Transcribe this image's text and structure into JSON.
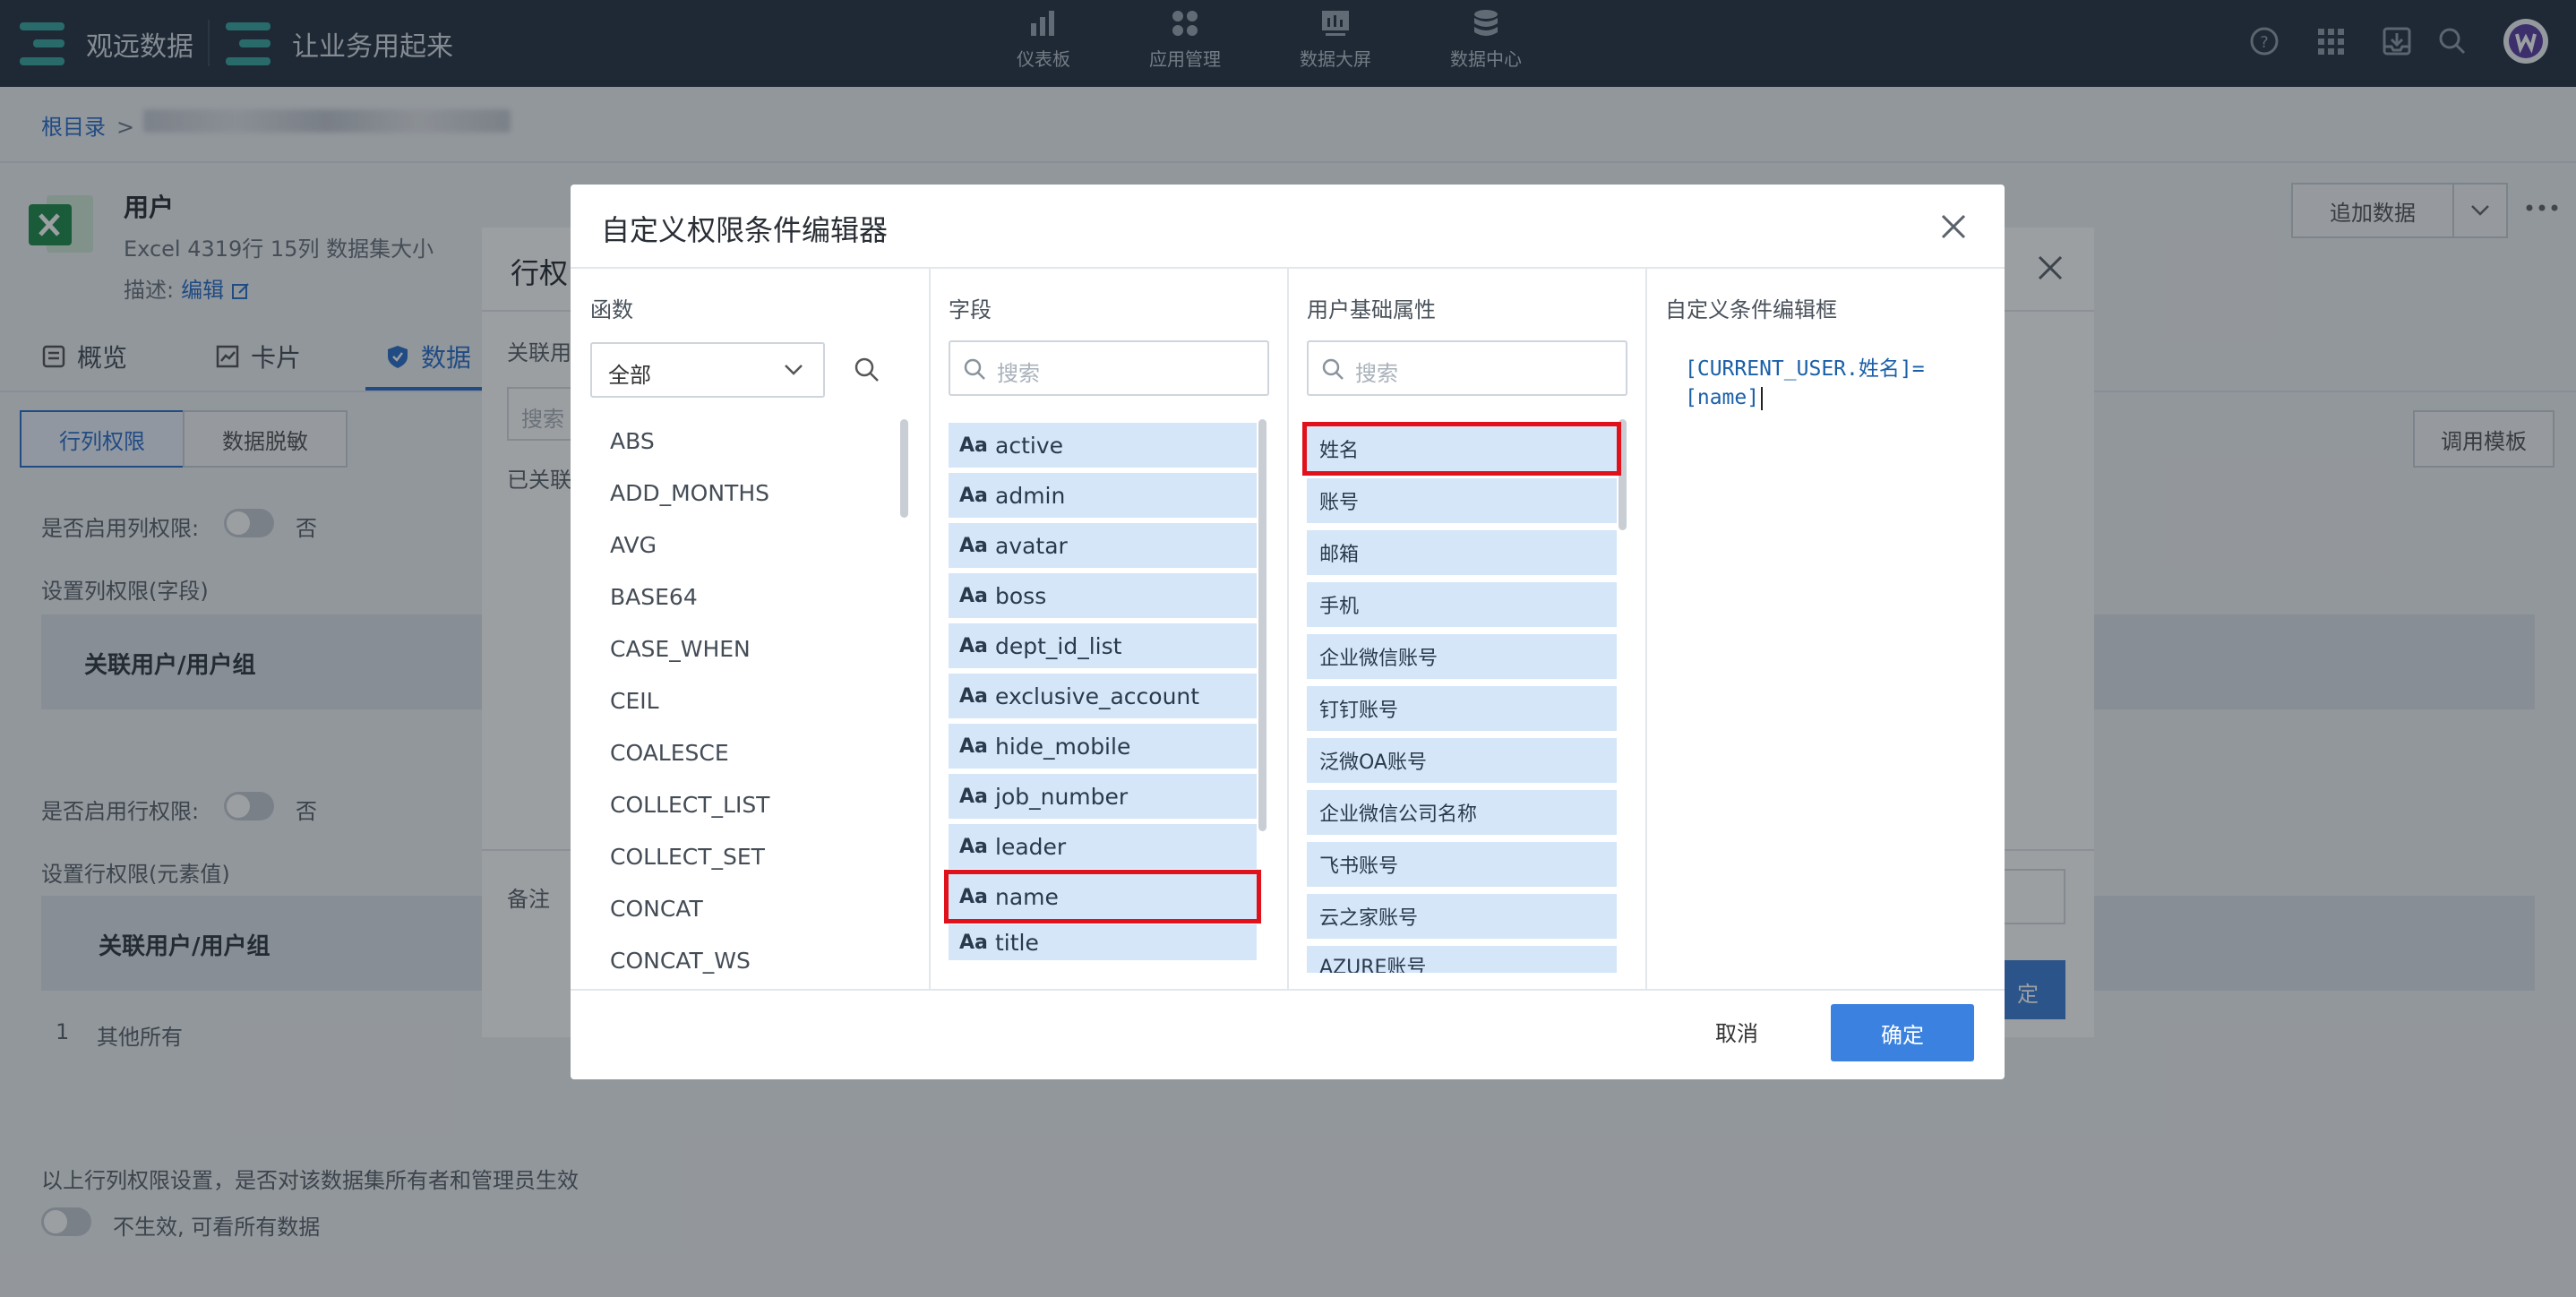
{
  "topnav": {
    "brand1": "观远数据",
    "brand2": "让业务用起来",
    "items": [
      {
        "label": "仪表板",
        "icon": "bar-chart-icon"
      },
      {
        "label": "应用管理",
        "icon": "apps-grid-icon"
      },
      {
        "label": "数据大屏",
        "icon": "big-screen-icon"
      },
      {
        "label": "数据中心",
        "icon": "database-icon"
      }
    ],
    "right_icons": [
      "help-icon",
      "app-grid-icon",
      "inbox-icon",
      "search-icon",
      "avatar"
    ]
  },
  "page": {
    "breadcrumb_root": "根目录",
    "breadcrumb_sep": ">",
    "dataset_title": "用户",
    "dataset_meta": "Excel    4319行    15列    数据集大小",
    "desc_label": "描述:",
    "desc_edit": "编辑",
    "tabs": [
      "概览",
      "卡片",
      "数据"
    ],
    "seg_row_col": "行列权限",
    "seg_mask": "数据脱敏",
    "col_perm_label": "是否启用列权限:",
    "col_perm_off": "否",
    "col_perm_setting": "设置列权限(字段)",
    "tbl_head1": "关联用户/用户组",
    "row_perm_label": "是否启用行权限:",
    "row_perm_off": "否",
    "row_perm_setting": "设置行权限(元素值)",
    "tbl_head2": "关联用户/用户组",
    "row1_index": "1",
    "row1_name": "其他所有",
    "owner_notice": "以上行列权限设置，是否对该数据集所有者和管理员生效",
    "owner_toggle_text": "不生效, 可看所有数据",
    "append_data": "追加数据",
    "template_btn": "调用模板"
  },
  "back_dialog": {
    "title": "行权",
    "assoc_label": "关联用",
    "search_ph": "搜索",
    "linked_label": "已关联",
    "remark_label": "备注",
    "confirm_partial": "定"
  },
  "dialog": {
    "title": "自定义权限条件编辑器",
    "col_functions": "函数",
    "col_fields": "字段",
    "col_user_attrs": "用户基础属性",
    "col_editor": "自定义条件编辑框",
    "func_select": "全部",
    "field_search_ph": "搜索",
    "attr_search_ph": "搜索",
    "functions": [
      "ABS",
      "ADD_MONTHS",
      "AVG",
      "BASE64",
      "CASE_WHEN",
      "CEIL",
      "COALESCE",
      "COLLECT_LIST",
      "COLLECT_SET",
      "CONCAT",
      "CONCAT_WS"
    ],
    "fields": [
      "active",
      "admin",
      "avatar",
      "boss",
      "dept_id_list",
      "exclusive_account",
      "hide_mobile",
      "job_number",
      "leader",
      "name",
      "title"
    ],
    "field_type": "Aa",
    "selected_field": "name",
    "user_attrs": [
      "姓名",
      "账号",
      "邮箱",
      "手机",
      "企业微信账号",
      "钉钉账号",
      "泛微OA账号",
      "企业微信公司名称",
      "飞书账号",
      "云之家账号",
      "AZURE账号"
    ],
    "selected_attr": "姓名",
    "editor_line1": "[CURRENT_USER.姓名]=",
    "editor_line2": "[name]",
    "cancel": "取消",
    "ok": "确定"
  },
  "colors": {
    "nav_bg": "#273444",
    "accent": "#3b82e0",
    "item_bg": "#d4e6f8",
    "highlight": "#e0111a"
  }
}
